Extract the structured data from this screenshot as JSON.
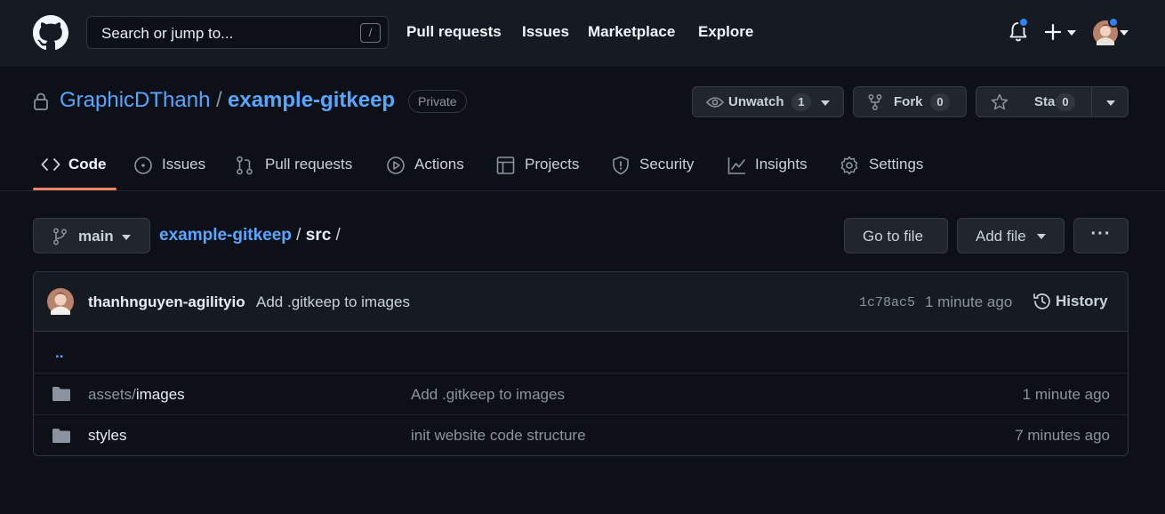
{
  "header": {
    "search_placeholder": "Search or jump to...",
    "search_shortcut": "/",
    "nav": [
      "Pull requests",
      "Issues",
      "Marketplace",
      "Explore"
    ]
  },
  "repo": {
    "owner": "GraphicDThanh",
    "separator": "/",
    "name": "example-gitkeep",
    "visibility": "Private",
    "unwatch_label": "Unwatch",
    "watch_count": "1",
    "fork_label": "Fork",
    "fork_count": "0",
    "star_label": "Star",
    "star_count": "0"
  },
  "tabs": [
    {
      "label": "Code",
      "icon": "code-icon",
      "active": true
    },
    {
      "label": "Issues",
      "icon": "issue-opened-icon"
    },
    {
      "label": "Pull requests",
      "icon": "git-pull-request-icon"
    },
    {
      "label": "Actions",
      "icon": "play-icon"
    },
    {
      "label": "Projects",
      "icon": "table-icon"
    },
    {
      "label": "Security",
      "icon": "shield-icon"
    },
    {
      "label": "Insights",
      "icon": "graph-icon"
    },
    {
      "label": "Settings",
      "icon": "gear-icon"
    }
  ],
  "browse": {
    "branch": "main",
    "path_repo": "example-gitkeep",
    "path_sep1": " / ",
    "path_dir": "src",
    "path_sep2": " /",
    "go_to_file": "Go to file",
    "add_file": "Add file",
    "more": "···"
  },
  "commit": {
    "author": "thanhnguyen-agilityio",
    "message": "Add .gitkeep to images",
    "sha": "1c78ac5",
    "time": "1 minute ago",
    "history_label": "History"
  },
  "files": {
    "parent": "..",
    "rows": [
      {
        "name_prefix": "assets/",
        "name": "images",
        "message": "Add .gitkeep to images",
        "age": "1 minute ago"
      },
      {
        "name_prefix": "",
        "name": "styles",
        "message": "init website code structure",
        "age": "7 minutes ago"
      }
    ]
  },
  "colors": {
    "accent_link": "#58a6ff",
    "tab_underline": "#f78166",
    "notification_dot": "#2f81f7",
    "background": "#0d1117"
  }
}
